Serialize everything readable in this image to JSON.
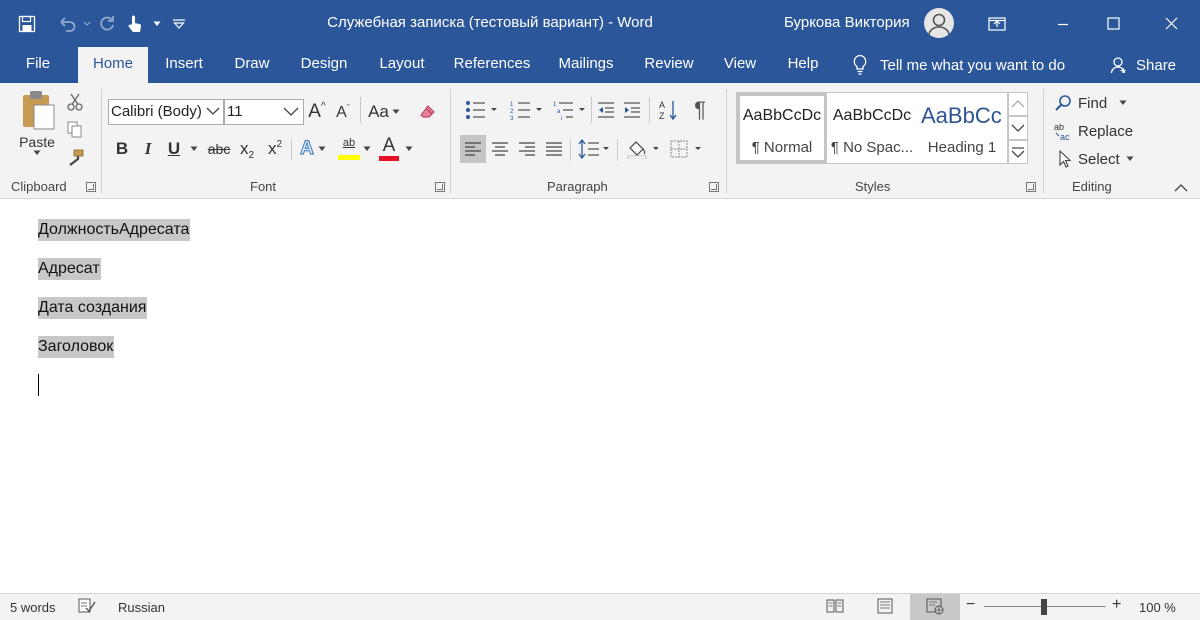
{
  "window": {
    "title": "Служебная записка (тестовый вариант)  -  Word",
    "user_name": "Буркова Виктория"
  },
  "quick_access": {
    "icons": [
      "save-icon",
      "undo-icon",
      "redo-icon",
      "touch-mode-icon",
      "customize-icon"
    ]
  },
  "tabs": [
    {
      "label": "File"
    },
    {
      "label": "Home"
    },
    {
      "label": "Insert"
    },
    {
      "label": "Draw"
    },
    {
      "label": "Design"
    },
    {
      "label": "Layout"
    },
    {
      "label": "References"
    },
    {
      "label": "Mailings"
    },
    {
      "label": "Review"
    },
    {
      "label": "View"
    },
    {
      "label": "Help"
    }
  ],
  "tellme": "Tell me what you want to do",
  "share": "Share",
  "ribbon": {
    "clipboard": {
      "label": "Clipboard",
      "paste": "Paste"
    },
    "font": {
      "label": "Font",
      "font_name": "Calibri (Body)",
      "font_size": "11",
      "case_label": "Aa",
      "bold": "B",
      "italic": "I",
      "underline": "U",
      "strikethrough": "abc",
      "subscript": "x",
      "superscript": "x",
      "sub_mark": "2",
      "sup_mark": "2",
      "highlight_label": "ab",
      "font_color_label": "A",
      "grow_label": "A",
      "shrink_label": "A",
      "effects_label": "A"
    },
    "paragraph": {
      "label": "Paragraph",
      "pilcrow": "¶"
    },
    "styles": {
      "label": "Styles",
      "items": [
        {
          "preview": "AaBbCcDc",
          "name": "¶ Normal"
        },
        {
          "preview": "AaBbCcDc",
          "name": "¶ No Spac..."
        },
        {
          "preview": "AaBbCc",
          "name": "Heading 1"
        }
      ]
    },
    "editing": {
      "label": "Editing",
      "find": "Find",
      "replace": "Replace",
      "select": "Select"
    }
  },
  "document": {
    "paragraphs": [
      "ДолжностьАдресата",
      "Адресат",
      "Дата создания",
      "Заголовок"
    ]
  },
  "status": {
    "words": "5 words",
    "language": "Russian",
    "zoom": "100 %",
    "zoom_minus": "−",
    "zoom_plus": "+",
    "zoom_level": 100
  },
  "colors": {
    "brand": "#2b579a",
    "highlight": "#ffff00",
    "font_color": "#e81123",
    "heading": "#2f5496"
  }
}
